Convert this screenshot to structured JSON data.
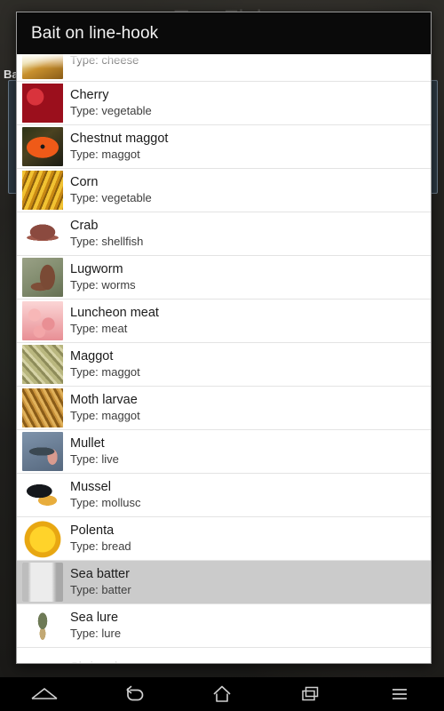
{
  "background_app": {
    "title": "TrueFish",
    "subtitle": "Baits",
    "section_label": "Ba"
  },
  "dialog": {
    "title": "Bait on line-hook",
    "items": [
      {
        "name": "",
        "type": "Type: cheese",
        "icon": "cheese-thumbnail",
        "partial": true,
        "selected": false
      },
      {
        "name": "Cherry",
        "type": "Type: vegetable",
        "icon": "cherry-thumbnail",
        "partial": false,
        "selected": false
      },
      {
        "name": "Chestnut maggot",
        "type": "Type: maggot",
        "icon": "chestnut-maggot-thumbnail",
        "partial": false,
        "selected": false
      },
      {
        "name": "Corn",
        "type": "Type: vegetable",
        "icon": "corn-thumbnail",
        "partial": false,
        "selected": false
      },
      {
        "name": "Crab",
        "type": "Type: shellfish",
        "icon": "crab-thumbnail",
        "partial": false,
        "selected": false
      },
      {
        "name": "Lugworm",
        "type": "Type: worms",
        "icon": "lugworm-thumbnail",
        "partial": false,
        "selected": false
      },
      {
        "name": "Luncheon meat",
        "type": "Type: meat",
        "icon": "luncheon-meat-thumbnail",
        "partial": false,
        "selected": false
      },
      {
        "name": "Maggot",
        "type": "Type: maggot",
        "icon": "maggot-thumbnail",
        "partial": false,
        "selected": false
      },
      {
        "name": "Moth larvae",
        "type": "Type: maggot",
        "icon": "moth-larvae-thumbnail",
        "partial": false,
        "selected": false
      },
      {
        "name": "Mullet",
        "type": "Type: live",
        "icon": "mullet-thumbnail",
        "partial": false,
        "selected": false
      },
      {
        "name": "Mussel",
        "type": "Type: mollusc",
        "icon": "mussel-thumbnail",
        "partial": false,
        "selected": false
      },
      {
        "name": "Polenta",
        "type": "Type: bread",
        "icon": "polenta-thumbnail",
        "partial": false,
        "selected": false
      },
      {
        "name": "Sea batter",
        "type": "Type: batter",
        "icon": "sea-batter-thumbnail",
        "partial": false,
        "selected": true
      },
      {
        "name": "Sea lure",
        "type": "Type: lure",
        "icon": "sea-lure-thumbnail",
        "partial": false,
        "selected": false
      },
      {
        "name": "Shrimp lure",
        "type": "",
        "icon": "shrimp-lure-thumbnail",
        "partial": false,
        "selected": false
      }
    ]
  },
  "navbar": {
    "buttons": [
      {
        "icon": "collapse-chevron-up-icon",
        "label": "Collapse"
      },
      {
        "icon": "back-arrow-icon",
        "label": "Back"
      },
      {
        "icon": "home-icon",
        "label": "Home"
      },
      {
        "icon": "recents-icon",
        "label": "Recent apps"
      },
      {
        "icon": "menu-icon",
        "label": "Menu"
      }
    ]
  },
  "colors": {
    "dialog_header_bg": "#0a0a0a",
    "dialog_bg": "#ffffff",
    "selected_row_bg": "#cbcbcb",
    "row_divider": "#e3e3e3",
    "navbar_bg": "#000000",
    "bg_panel_border": "#6d7d8c"
  }
}
